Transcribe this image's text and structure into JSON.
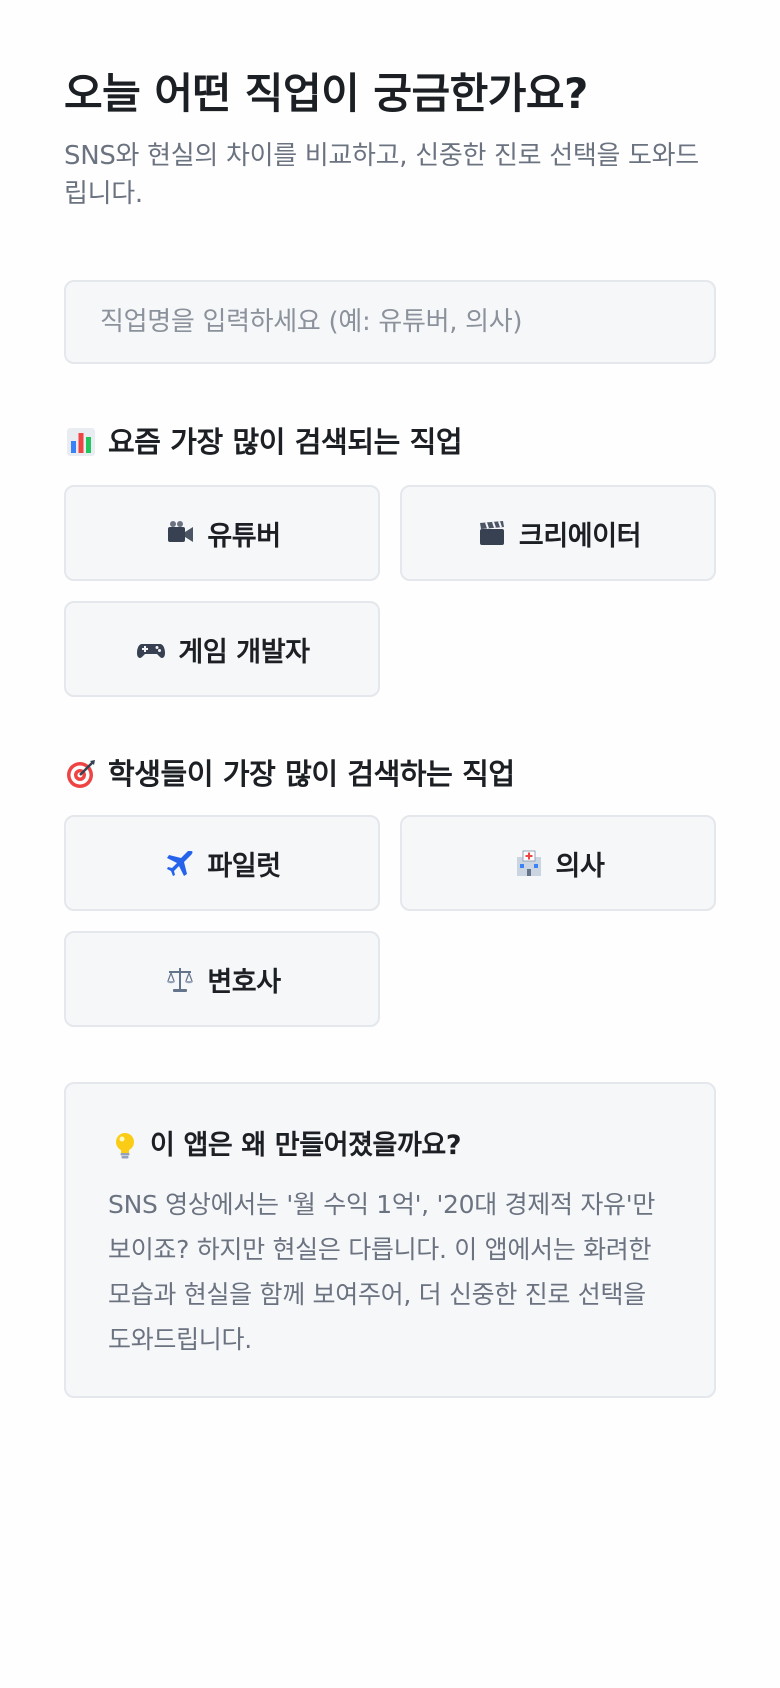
{
  "header": {
    "title": "오늘 어떤 직업이 궁금한가요?",
    "subtitle": "SNS와 현실의 차이를 비교하고, 신중한 진로 선택을 도와드립니다."
  },
  "search": {
    "placeholder": "직업명을 입력하세요 (예: 유튜버, 의사)",
    "value": ""
  },
  "trending": {
    "icon": "bar-chart-icon",
    "heading": "요즘 가장 많이 검색되는 직업",
    "jobs": [
      {
        "icon": "video-camera-icon",
        "label": "유튜버"
      },
      {
        "icon": "clapperboard-icon",
        "label": "크리에이터"
      },
      {
        "icon": "game-controller-icon",
        "label": "게임 개발자"
      }
    ]
  },
  "student_popular": {
    "icon": "target-icon",
    "heading": "학생들이 가장 많이 검색하는 직업",
    "jobs": [
      {
        "icon": "airplane-icon",
        "label": "파일럿"
      },
      {
        "icon": "hospital-icon",
        "label": "의사"
      },
      {
        "icon": "scales-icon",
        "label": "변호사"
      }
    ]
  },
  "info_card": {
    "icon": "light-bulb-icon",
    "heading": "이 앱은 왜 만들어졌을까요?",
    "body": "SNS 영상에서는 '월 수익 1억', '20대 경제적 자유'만 보이죠? 하지만 현실은 다릅니다. 이 앱에서는 화려한 모습과 현실을 함께 보여주어, 더 신중한 진로 선택을 도와드립니다."
  },
  "colors": {
    "background": "#fefefe",
    "card_background": "#f6f7f9",
    "card_border": "#e4e7eb",
    "title_text": "#1c1f23",
    "muted_text": "#6b7280",
    "placeholder_text": "#8b929b"
  }
}
